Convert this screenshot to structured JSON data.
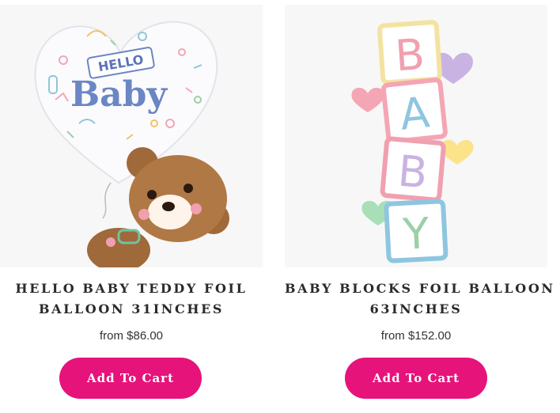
{
  "products": [
    {
      "title_line1": "HELLO BABY TEDDY FOIL",
      "title_line2": "BALLOON 31INCHES",
      "price": "from $86.00",
      "button_label": "Add To Cart",
      "image_text_1": "HELLO",
      "image_text_2": "Baby"
    },
    {
      "title_line1": "BABY BLOCKS FOIL BALLOON",
      "title_line2": "63INCHES",
      "price": "from $152.00",
      "button_label": "Add To Cart",
      "block_letters": [
        "B",
        "A",
        "B",
        "Y"
      ]
    }
  ],
  "colors": {
    "accent": "#e6137b",
    "image_bg": "#f7f7f7",
    "title_text": "#2a2a2a"
  }
}
